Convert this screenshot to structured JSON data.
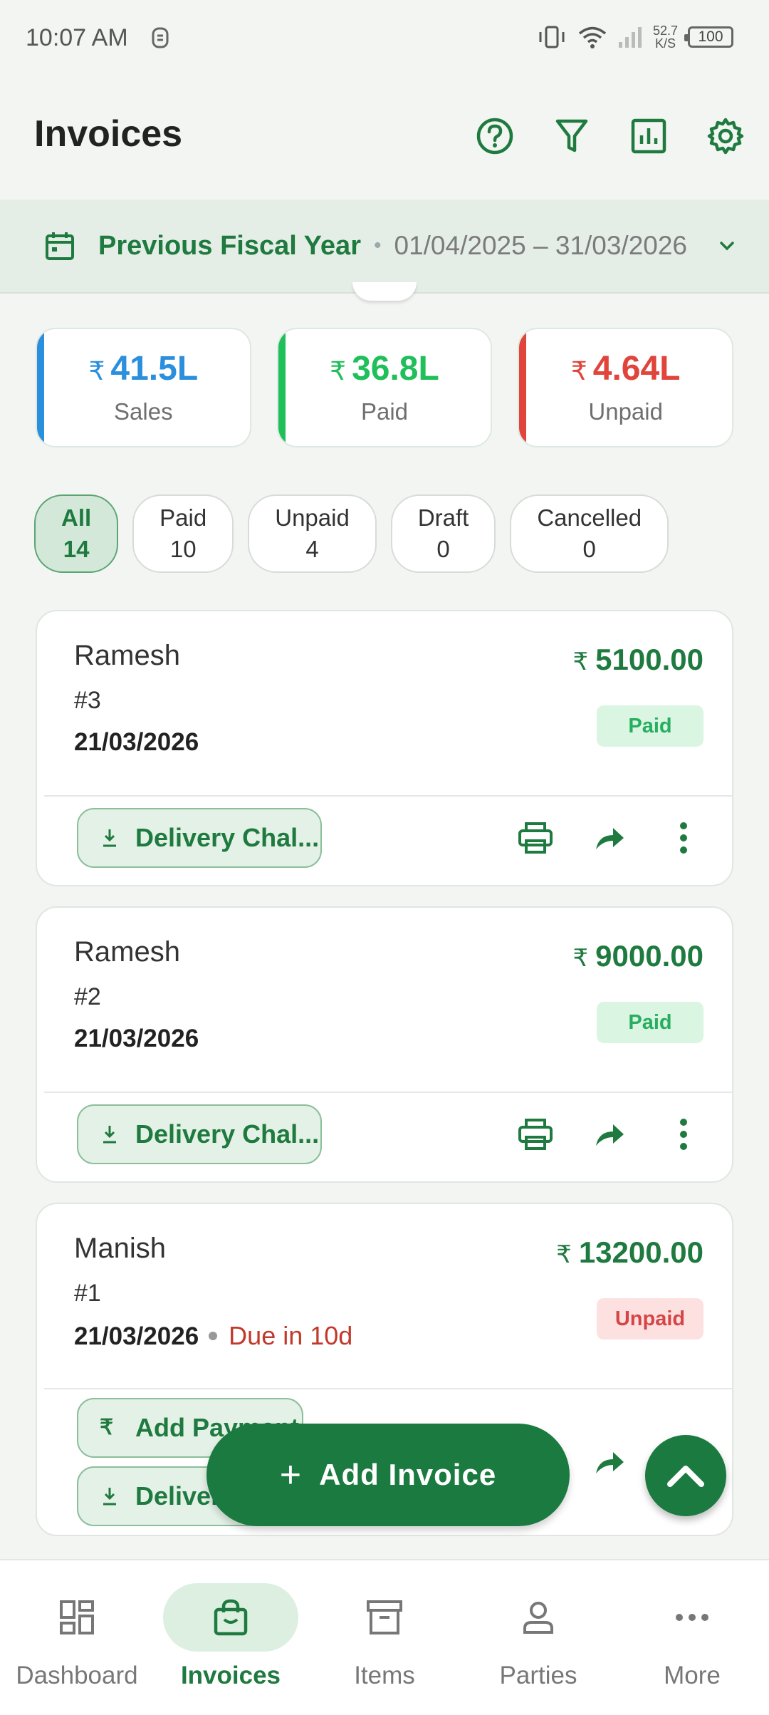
{
  "status_bar": {
    "time": "10:07 AM",
    "speed_top": "52.7",
    "speed_bottom": "K/S",
    "battery": "100"
  },
  "header": {
    "title": "Invoices",
    "actions": [
      "help-icon",
      "filter-icon",
      "reports-icon",
      "settings-icon"
    ]
  },
  "date_range": {
    "label": "Previous Fiscal Year",
    "range": "01/04/2025 – 31/03/2026"
  },
  "summary": [
    {
      "currency": "₹",
      "amount": "41.5L",
      "label": "Sales",
      "color": "#2a8fdc"
    },
    {
      "currency": "₹",
      "amount": "36.8L",
      "label": "Paid",
      "color": "#1fbf5a"
    },
    {
      "currency": "₹",
      "amount": "4.64L",
      "label": "Unpaid",
      "color": "#e0443a"
    }
  ],
  "filters": [
    {
      "label": "All",
      "count": "14",
      "active": true
    },
    {
      "label": "Paid",
      "count": "10"
    },
    {
      "label": "Unpaid",
      "count": "4"
    },
    {
      "label": "Draft",
      "count": "0"
    },
    {
      "label": "Cancelled",
      "count": "0"
    }
  ],
  "invoices": [
    {
      "name": "Ramesh",
      "number": "#3",
      "date": "21/03/2026",
      "currency": "₹",
      "amount": "5100.00",
      "status": "Paid",
      "button": "Delivery Chal..."
    },
    {
      "name": "Ramesh",
      "number": "#2",
      "date": "21/03/2026",
      "currency": "₹",
      "amount": "9000.00",
      "status": "Paid",
      "button": "Delivery Chal..."
    },
    {
      "name": "Manish",
      "number": "#1",
      "date": "21/03/2026",
      "due": "Due in 10d",
      "currency": "₹",
      "amount": "13200.00",
      "status": "Unpaid",
      "button": "Add Payment",
      "button2": "Delivery Chal..."
    }
  ],
  "fab": {
    "add_label": "Add Invoice"
  },
  "bottom_nav": [
    {
      "label": "Dashboard",
      "icon": "dashboard-icon"
    },
    {
      "label": "Invoices",
      "icon": "bag-icon",
      "active": true
    },
    {
      "label": "Items",
      "icon": "archive-icon"
    },
    {
      "label": "Parties",
      "icon": "person-icon"
    },
    {
      "label": "More",
      "icon": "more-icon"
    }
  ],
  "colors": {
    "brand": "#1a7a40",
    "accent_text": "#1f7a3f"
  }
}
